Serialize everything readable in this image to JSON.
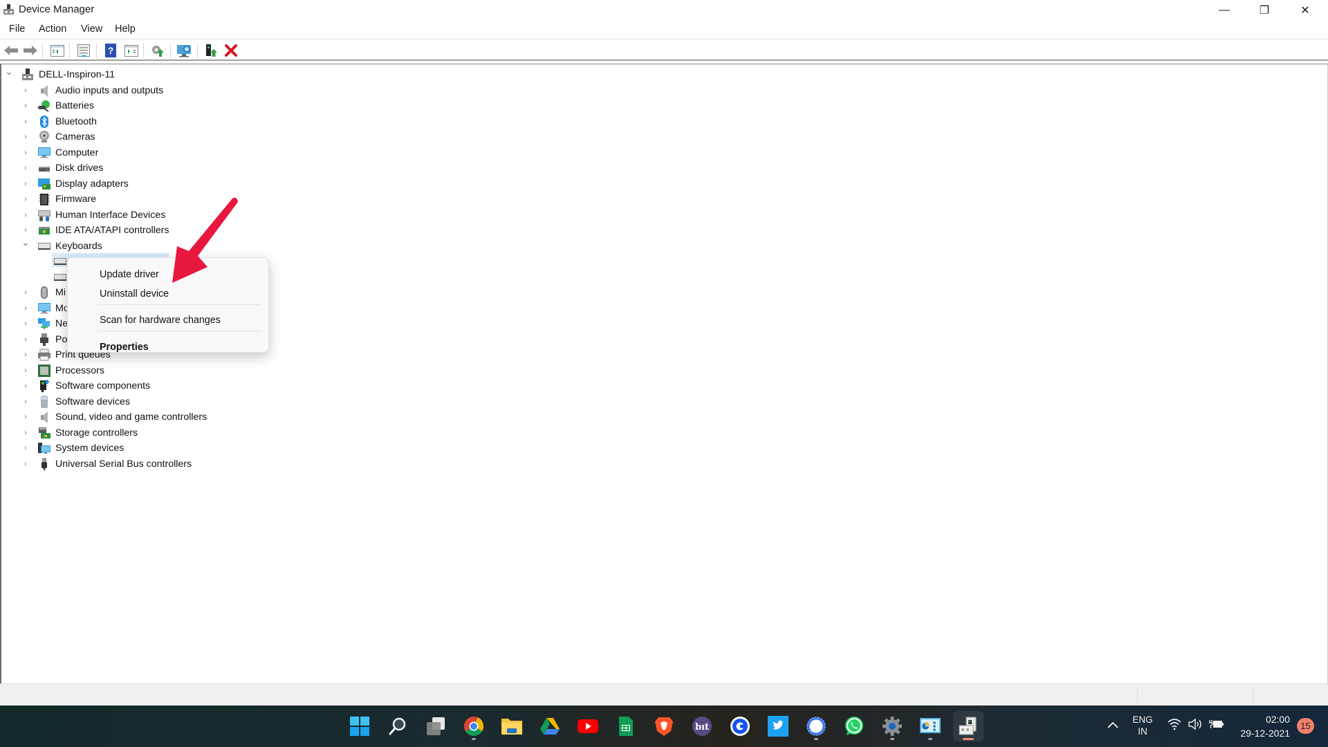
{
  "window": {
    "title": "Device Manager",
    "controls": {
      "minimize": "—",
      "restore": "❐",
      "close": "✕"
    }
  },
  "menubar": [
    "File",
    "Action",
    "View",
    "Help"
  ],
  "toolbar": {
    "buttons": [
      "back",
      "forward",
      "show-hide-console-tree",
      "properties",
      "help",
      "show-hide-action-pane",
      "update-driver",
      "scan-for-hardware-changes",
      "add-legacy-hardware",
      "uninstall-device"
    ]
  },
  "tree": {
    "root": "DELL-Inspiron-11",
    "categories": [
      {
        "label": "Audio inputs and outputs",
        "icon": "speaker-icon",
        "expanded": false
      },
      {
        "label": "Batteries",
        "icon": "battery-icon",
        "expanded": false
      },
      {
        "label": "Bluetooth",
        "icon": "bluetooth-icon",
        "expanded": false
      },
      {
        "label": "Cameras",
        "icon": "camera-icon",
        "expanded": false
      },
      {
        "label": "Computer",
        "icon": "monitor-icon",
        "expanded": false
      },
      {
        "label": "Disk drives",
        "icon": "disk-drive-icon",
        "expanded": false
      },
      {
        "label": "Display adapters",
        "icon": "display-adapter-icon",
        "expanded": false
      },
      {
        "label": "Firmware",
        "icon": "chip-icon",
        "expanded": false
      },
      {
        "label": "Human Interface Devices",
        "icon": "hid-icon",
        "expanded": false
      },
      {
        "label": "IDE ATA/ATAPI controllers",
        "icon": "controller-card-icon",
        "expanded": false
      },
      {
        "label": "Keyboards",
        "icon": "keyboard-icon",
        "expanded": true
      },
      {
        "label": "Mi",
        "icon": "mouse-icon",
        "expanded": false
      },
      {
        "label": "Mo",
        "icon": "monitor-icon",
        "expanded": false
      },
      {
        "label": "Ne",
        "icon": "network-icon",
        "expanded": false
      },
      {
        "label": "Po",
        "icon": "port-icon",
        "expanded": false
      },
      {
        "label": "Print queues",
        "icon": "printer-icon",
        "expanded": false
      },
      {
        "label": "Processors",
        "icon": "processor-icon",
        "expanded": false
      },
      {
        "label": "Software components",
        "icon": "software-component-icon",
        "expanded": false
      },
      {
        "label": "Software devices",
        "icon": "software-device-icon",
        "expanded": false
      },
      {
        "label": "Sound, video and game controllers",
        "icon": "speaker-icon",
        "expanded": false
      },
      {
        "label": "Storage controllers",
        "icon": "storage-controller-icon",
        "expanded": false
      },
      {
        "label": "System devices",
        "icon": "system-devices-icon",
        "expanded": false
      },
      {
        "label": "Universal Serial Bus controllers",
        "icon": "usb-icon",
        "expanded": false
      }
    ],
    "keyboard_children_count": 2
  },
  "context_menu": {
    "items": [
      "Update driver",
      "Uninstall device",
      "Scan for hardware changes",
      "Properties"
    ]
  },
  "annotation": {
    "type": "red-arrow",
    "points_to": "Update driver",
    "color": "#e8173f"
  },
  "taskbar": {
    "apps": [
      "start",
      "search",
      "task-view",
      "chrome",
      "file-explorer",
      "google-drive",
      "youtube",
      "google-sheets",
      "brave",
      "bit",
      "coinbase",
      "twitter",
      "signal",
      "whatsapp",
      "settings",
      "control-panel",
      "device-manager"
    ],
    "tray": {
      "language_line1": "ENG",
      "language_line2": "IN",
      "time": "02:00",
      "date": "29-12-2021",
      "notification_count": "15"
    }
  },
  "colors": {
    "selection": "#d9ebf9",
    "accent_badge": "#f0806b",
    "arrow": "#e8173f"
  }
}
